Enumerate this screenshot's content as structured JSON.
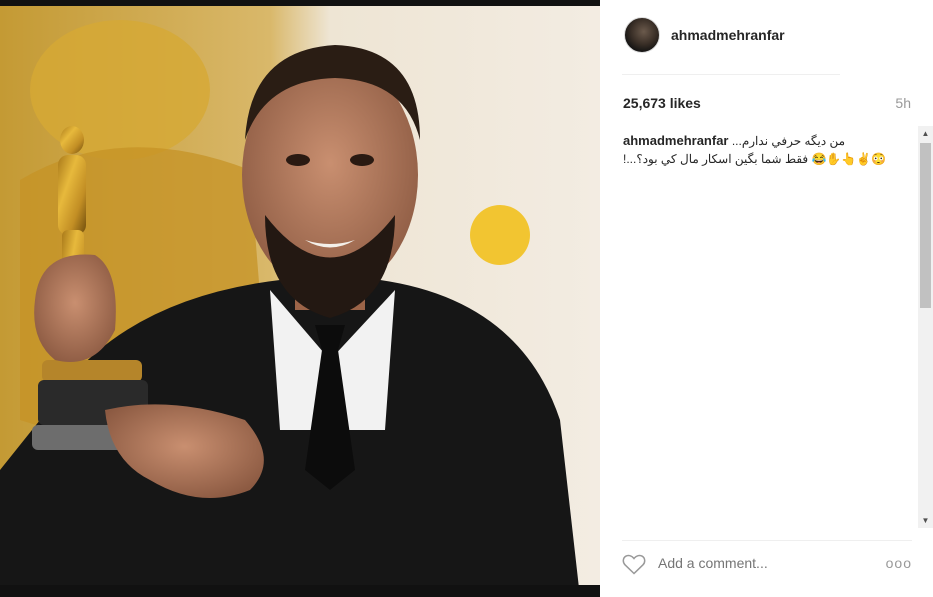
{
  "post": {
    "username": "ahmadmehranfar",
    "likes": "25,673 likes",
    "time": "5h",
    "caption": {
      "username": "ahmadmehranfar",
      "line1": "من ديگه حرفي ندارم...",
      "line2": "😳✌👆✋😂 فقط شما بگين اسكار مال كي بود؟...!"
    }
  },
  "footer": {
    "comment_placeholder": "Add a comment...",
    "more_label": "ooo"
  },
  "icons": {
    "like": "heart-outline-icon",
    "more": "ellipsis-icon"
  },
  "colors": {
    "background": "#ffffff",
    "text": "#262626",
    "muted": "#999999"
  }
}
